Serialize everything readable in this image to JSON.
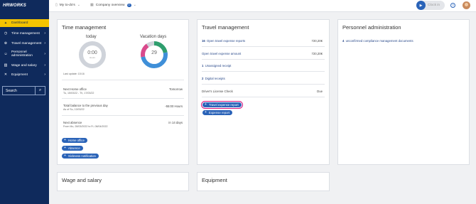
{
  "sidebar": {
    "logo": "HRWORKS",
    "items": [
      {
        "label": "Dashboard",
        "icon": "star-icon"
      },
      {
        "label": "Time management",
        "icon": "clock-icon"
      },
      {
        "label": "Travel management",
        "icon": "globe-icon"
      },
      {
        "label": "Personnel administration",
        "icon": "people-icon"
      },
      {
        "label": "Wage and salary",
        "icon": "chart-icon"
      },
      {
        "label": "Equipment",
        "icon": "tools-icon"
      }
    ],
    "search_placeholder": "Search"
  },
  "header": {
    "todos_label": "My to-do's",
    "company_label": "Company overview",
    "company_badge": "0",
    "clockin_label": "Clock in",
    "help": "?"
  },
  "time_management": {
    "title": "Time management",
    "today_label": "today",
    "today_value": "0:00",
    "today_unit": "Hours",
    "vacation_label": "Vacation days",
    "vacation_value": "29",
    "last_update": "Last update: 15:16",
    "next_home_label": "Next Home office",
    "next_home_dates": "Tu, 15/03/22 - Th, 17/03/22",
    "next_home_value": "Tomorrow",
    "balance_label": "Total balance to the previous day",
    "balance_date": "As of Su, 13/03/22",
    "balance_value": "-55:00 Hours",
    "absence_label": "Next absence",
    "absence_dates": "From Mo, 28/03/2022 to Fr, 08/04/2022",
    "absence_value": "in 14 days",
    "buttons": [
      "Home office",
      "Absence",
      "Sickness notification"
    ],
    "vacation_segments": [
      {
        "color": "#2f9e6e",
        "fraction": 0.22
      },
      {
        "color": "#3f8fd8",
        "fraction": 0.5
      },
      {
        "color": "#d94a8c",
        "fraction": 0.18
      },
      {
        "color": "#cfd3da",
        "fraction": 0.1
      }
    ]
  },
  "travel_management": {
    "title": "Travel management",
    "rows": [
      {
        "num": "16",
        "text": "Open travel expense reports",
        "amount": "720,20€"
      },
      {
        "num": "",
        "text": "Open travel expense amount",
        "amount": "720,20€"
      },
      {
        "num": "1",
        "text": "Unassigned receipt",
        "amount": ""
      },
      {
        "num": "2",
        "text": "Digital receipts",
        "amount": ""
      },
      {
        "num": "",
        "text": "Driver's License Check",
        "amount": "Due"
      }
    ],
    "buttons": [
      "Travel expense report",
      "Expense report"
    ]
  },
  "personnel_administration": {
    "title": "Personnel administration",
    "row_num": "4",
    "row_text": "unconfirmed compliance management documents"
  },
  "wage_salary": {
    "title": "Wage and salary"
  },
  "equipment": {
    "title": "Equipment"
  }
}
